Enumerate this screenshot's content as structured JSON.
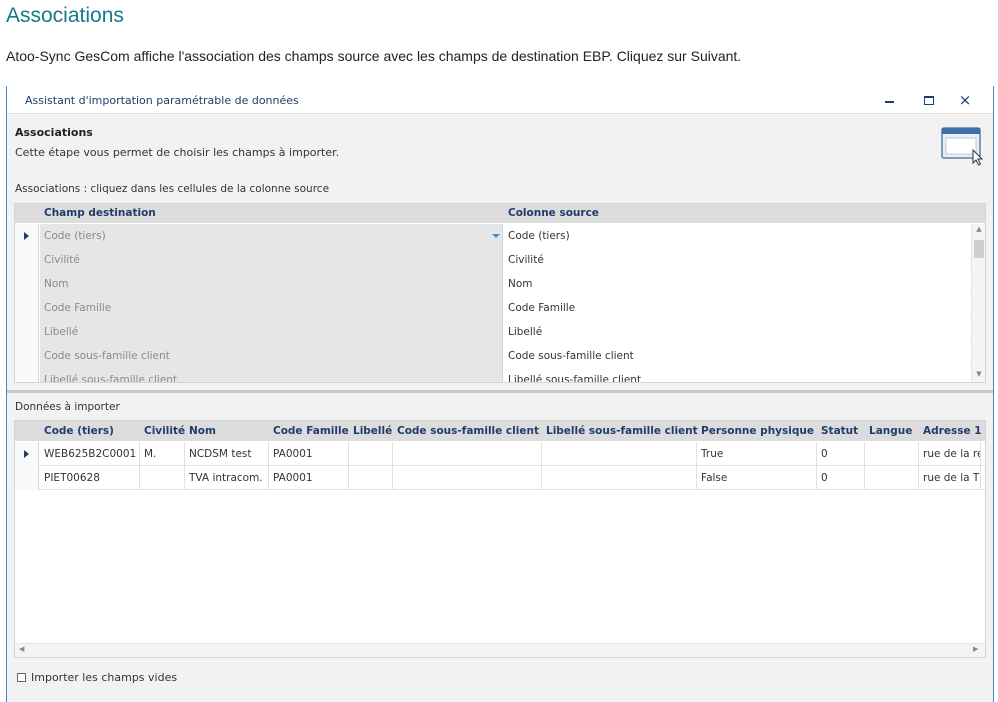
{
  "doc": {
    "title": "Associations",
    "intro": "Atoo-Sync GesCom affiche l'association des champs source avec les champs de destination EBP. Cliquez sur Suivant."
  },
  "window": {
    "title": "Assistant d'importation paramétrable de données",
    "controls": {
      "minimize": "minimize-icon",
      "maximize": "maximize-icon",
      "close": "×"
    }
  },
  "step": {
    "title": "Associations",
    "description": "Cette étape vous permet de choisir les champs à importer.",
    "icon": "window-cursor-icon"
  },
  "associations": {
    "label": "Associations : cliquez dans les cellules de la colonne source",
    "columns": {
      "destination": "Champ destination",
      "source": "Colonne source"
    },
    "rows": [
      {
        "destination": "Code (tiers)",
        "source": "Code (tiers)",
        "selected": true
      },
      {
        "destination": "Civilité",
        "source": "Civilité"
      },
      {
        "destination": "Nom",
        "source": "Nom"
      },
      {
        "destination": "Code Famille",
        "source": "Code Famille"
      },
      {
        "destination": "Libellé",
        "source": "Libellé"
      },
      {
        "destination": "Code sous-famille client",
        "source": "Code sous-famille client"
      },
      {
        "destination": "Libellé sous-famille client",
        "source": "Libellé sous-famille client"
      }
    ]
  },
  "data": {
    "label": "Données à importer",
    "columns": [
      "Code (tiers)",
      "Civilité",
      "Nom",
      "Code Famille",
      "Libellé",
      "Code sous-famille client",
      "Libellé sous-famille client",
      "Personne physique",
      "Statut",
      "Langue",
      "Adresse 1"
    ],
    "rows": [
      [
        "WEB625B2C0001",
        "M.",
        "NCDSM test",
        "PA0001",
        "",
        "",
        "",
        "True",
        "0",
        "",
        "rue de la re"
      ],
      [
        "PIET00628",
        "",
        "TVA intracom.",
        "PA0001",
        "",
        "",
        "",
        "False",
        "0",
        "",
        "rue de la T"
      ]
    ]
  },
  "options": {
    "import_empty_label": "Importer les champs vides",
    "import_empty_checked": false
  },
  "colors": {
    "doc_title": "#17788c",
    "window_border": "#4a86c5",
    "header_text": "#1f3d6b",
    "dropdown_accent": "#3f8fd2"
  }
}
